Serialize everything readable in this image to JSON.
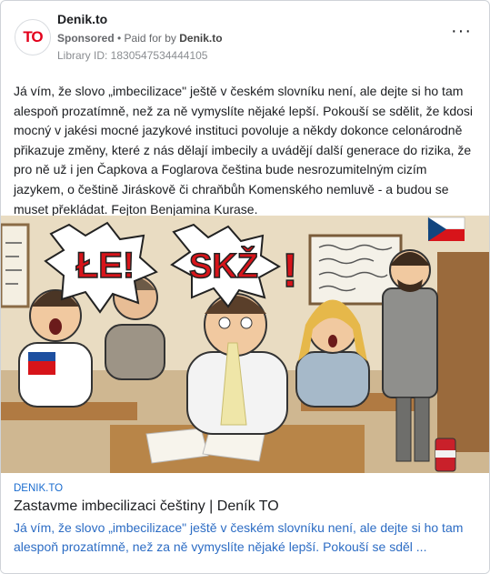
{
  "header": {
    "logo_text": "TO",
    "page_name": "Denik.to",
    "sponsored": "Sponsored",
    "separator": " • ",
    "paid_for_prefix": "Paid for by ",
    "paid_for_name": "Denik.to",
    "library_id": "Library ID: 1830547534444105",
    "more_icon": "more-options-icon"
  },
  "post": {
    "text": "Já vím, že slovo „imbecilizace\" ještě v českém slovníku není, ale dejte si ho tam alespoň prozatímně, než za ně vymyslíte nějaké lepší. Pokouší se sdělit, že kdosi mocný v jakési mocné jazykové instituci povoluje a někdy dokonce celonárodně přikazuje změny, které z nás dělají imbecily a uvádějí další generace do rizika, že pro ně už i jen Čapkova a Foglarova čeština bude nesrozumitelným cizím jazykem, o češtině Jiráskově či chraňbůh Komenského nemluvě - a budou se muset překládat. Fejton Benjamina Kurase."
  },
  "image": {
    "speech_1": "ŁE!",
    "speech_2": "SKŽ",
    "speech_3": "!"
  },
  "link": {
    "domain": "DENIK.TO",
    "title": "Zastavme imbecilizaci češtiny | Deník TO",
    "description": "Já vím, že slovo „imbecilizace\" ještě v českém slovníku není, ale dejte si ho tam alespoň prozatímně, než za ně vymyslíte nějaké lepší. Pokouší se sděl ..."
  },
  "colors": {
    "brand_red": "#e3001b",
    "link_blue": "#2c6cc4"
  }
}
